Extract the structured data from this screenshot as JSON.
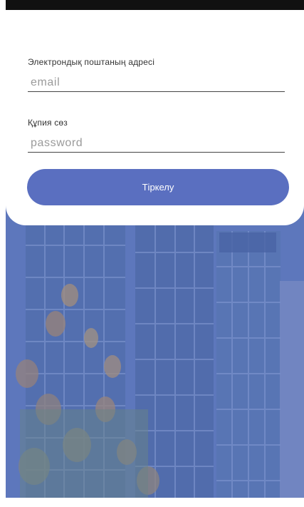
{
  "login_form": {
    "email_label": "Электрондық поштаның адресі",
    "email_placeholder": "email",
    "password_label": "Құпия сөз",
    "password_placeholder": "password",
    "submit_label": "Тіркелу"
  },
  "colors": {
    "accent": "#5a6fc0",
    "background_tint": "#5e78bd",
    "card": "#ffffff"
  }
}
